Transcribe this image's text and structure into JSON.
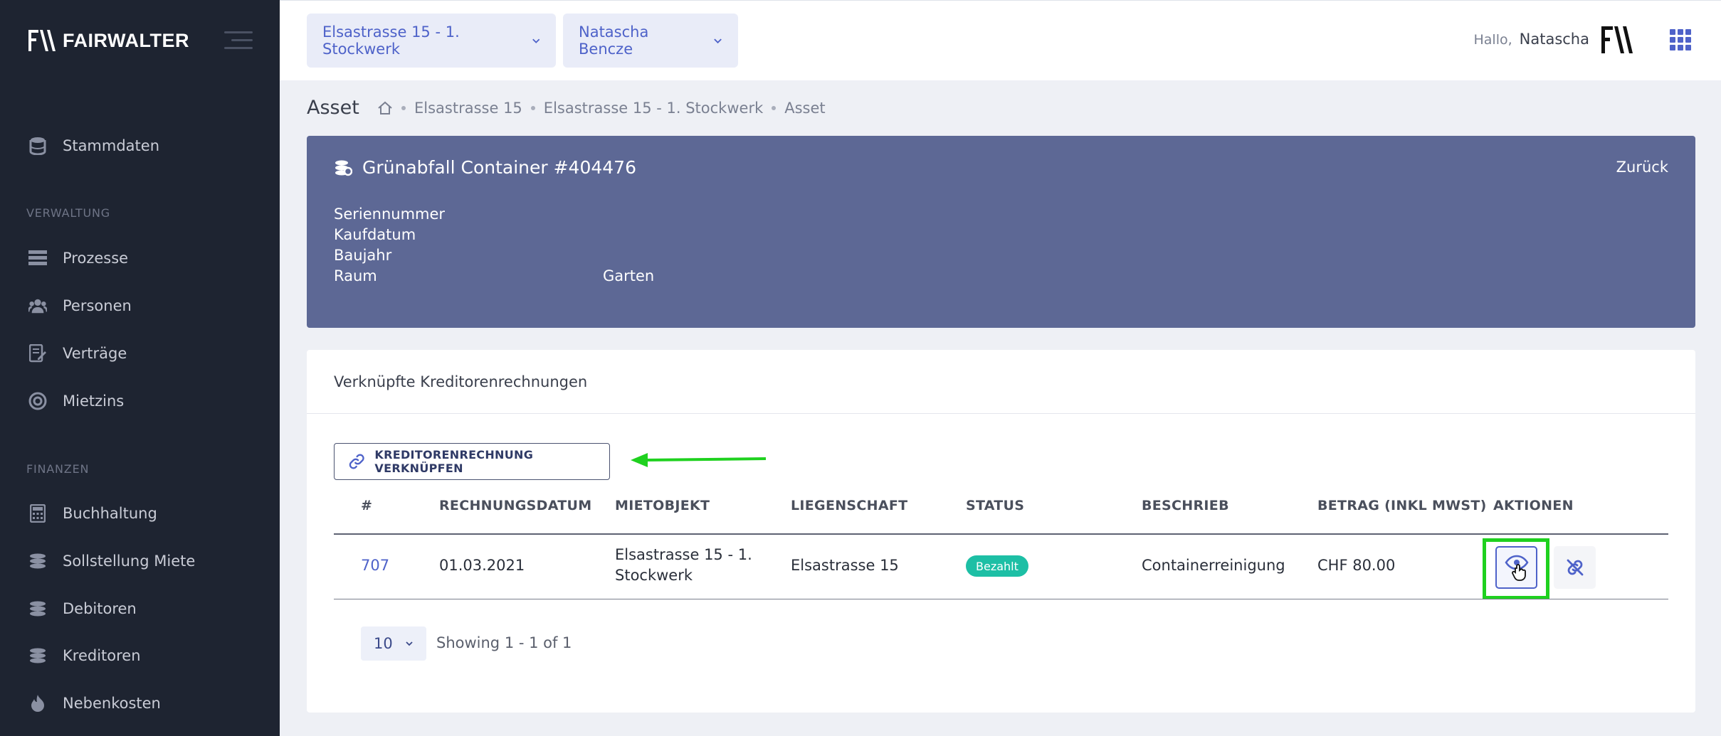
{
  "brand": {
    "name": "FAIRWALTER"
  },
  "sidebar": {
    "top_items": [
      {
        "label": "Stammdaten",
        "icon": "database-icon"
      }
    ],
    "sections": [
      {
        "title": "VERWALTUNG",
        "items": [
          {
            "label": "Prozesse",
            "icon": "process-icon"
          },
          {
            "label": "Personen",
            "icon": "users-icon"
          },
          {
            "label": "Verträge",
            "icon": "contract-icon"
          },
          {
            "label": "Mietzins",
            "icon": "rent-icon"
          }
        ]
      },
      {
        "title": "FINANZEN",
        "items": [
          {
            "label": "Buchhaltung",
            "icon": "calculator-icon"
          },
          {
            "label": "Sollstellung Miete",
            "icon": "coins-icon"
          },
          {
            "label": "Debitoren",
            "icon": "coins-icon"
          },
          {
            "label": "Kreditoren",
            "icon": "coins-icon"
          },
          {
            "label": "Nebenkosten",
            "icon": "flame-icon"
          }
        ]
      }
    ]
  },
  "topbar": {
    "property_select": "Elsastrasse 15 - 1. Stockwerk",
    "person_select": "Natascha Bencze",
    "greeting": "Hallo,",
    "user_name": "Natascha"
  },
  "page": {
    "title": "Asset",
    "breadcrumb": [
      "Elsastrasse 15",
      "Elsastrasse 15 - 1. Stockwerk",
      "Asset"
    ]
  },
  "asset": {
    "title": "Grünabfall Container #404476",
    "back_label": "Zurück",
    "properties": [
      {
        "key": "Seriennummer",
        "value": ""
      },
      {
        "key": "Kaufdatum",
        "value": ""
      },
      {
        "key": "Baujahr",
        "value": ""
      },
      {
        "key": "Raum",
        "value": "Garten"
      }
    ]
  },
  "invoices": {
    "header": "Verknüpfte Kreditorenrechnungen",
    "link_button": "KREDITORENRECHNUNG VERKNÜPFEN",
    "columns": [
      "#",
      "RECHNUNGSDATUM",
      "MIETOBJEKT",
      "LIEGENSCHAFT",
      "STATUS",
      "BESCHRIEB",
      "BETRAG (INKL MWST)",
      "AKTIONEN"
    ],
    "rows": [
      {
        "id": "707",
        "date": "01.03.2021",
        "object_line1": "Elsastrasse 15 - 1.",
        "object_line2": "Stockwerk",
        "property": "Elsastrasse 15",
        "status": "Bezahlt",
        "description": "Containerreinigung",
        "amount": "CHF 80.00"
      }
    ],
    "page_size": "10",
    "showing": "Showing 1 - 1 of 1"
  },
  "colors": {
    "sidebar_bg": "#1e2431",
    "accent": "#4e62c9",
    "asset_card": "#5d6895",
    "status_paid": "#1dbfa5",
    "highlight": "#1fd11f"
  }
}
